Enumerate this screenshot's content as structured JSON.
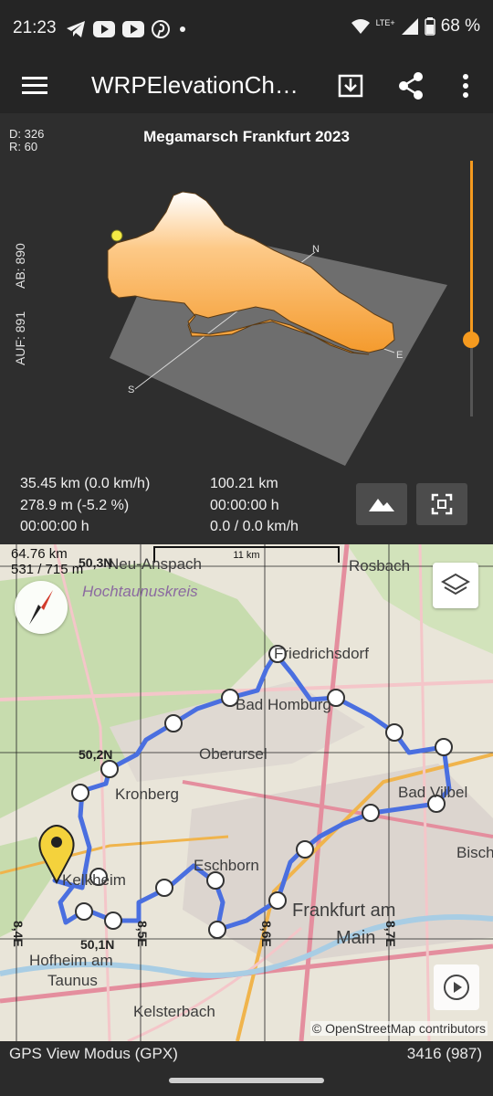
{
  "status_bar": {
    "time": "21:23",
    "left_icons": [
      "telegram-icon",
      "youtube-icon",
      "youtube-icon",
      "pinterest-icon",
      "dot-icon"
    ],
    "network": "LTE+",
    "battery": "68 %"
  },
  "app_bar": {
    "title": "WRPElevationCh…",
    "actions": [
      "download-icon",
      "share-icon",
      "more-vert-icon"
    ]
  },
  "chart": {
    "corner_info": [
      "D: 326",
      "R: 60"
    ],
    "title": "Megamarsch Frankfurt 2023",
    "axis_labels": {
      "ab": "AB: 890",
      "auf": "AUF: 891"
    },
    "compass_labels": {
      "n": "N",
      "e": "E",
      "s": "S"
    },
    "slider_level": 0.7,
    "stats_left": [
      "35.45 km (0.0 km/h)",
      "278.9 m (-5.2 %)",
      "00:00:00 h"
    ],
    "stats_right": [
      "100.21 km",
      "00:00:00 h",
      "0.0 / 0.0 km/h"
    ],
    "buttons": [
      "mountain-icon",
      "fullscreen-icon"
    ],
    "colors": {
      "relief": "#f6a23a",
      "accent": "#f59a1f"
    }
  },
  "map": {
    "info": [
      "64.76 km",
      "531 / 715 m"
    ],
    "scale_label": "11 km",
    "places": {
      "usingen": "Neu-Anspach",
      "rosbach": "Rosbach",
      "hochtaunus": "Hochtaunuskreis",
      "friedrichsdorf": "Friedrichsdorf",
      "bad_homburg": "Bad Homburg",
      "oberursel": "Oberursel",
      "kronberg": "Kronberg",
      "bad_vilbel": "Bad Vilbel",
      "bisch": "Bisch",
      "eschborn": "Eschborn",
      "frankfurt1": "Frankfurt am",
      "frankfurt2": "Main",
      "koenigstein": "Kelkheim",
      "hofheim1": "Hofheim am",
      "hofheim2": "Taunus",
      "kelsterbach": "Kelsterbach"
    },
    "grid_labels": {
      "n503": "50,3N",
      "n502": "50,2N",
      "n501": "50,1N",
      "e84": "8,4E",
      "e85": "8,5E",
      "e86": "8,6E",
      "e87": "8,7E"
    },
    "attribution": "© OpenStreetMap contributors",
    "route_color": "#4a6fe0"
  },
  "bottom_bar": {
    "mode": "GPS View Modus (GPX)",
    "count": "3416 (987)"
  }
}
